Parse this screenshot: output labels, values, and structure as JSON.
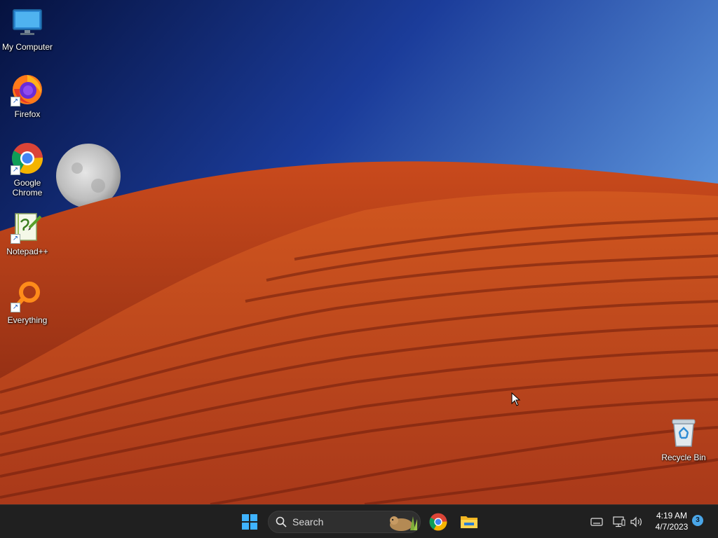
{
  "desktop_icons": [
    {
      "label": "My Computer",
      "icon": "monitor-icon"
    },
    {
      "label": "Firefox",
      "icon": "firefox-icon"
    },
    {
      "label": "Google Chrome",
      "icon": "chrome-icon"
    },
    {
      "label": "Notepad++",
      "icon": "notepadpp-icon"
    },
    {
      "label": "Everything",
      "icon": "everything-search-icon"
    },
    {
      "label": "Recycle Bin",
      "icon": "recycle-bin-icon"
    }
  ],
  "taskbar": {
    "search_label": "Search",
    "pinned": [
      "start-windows-icon",
      "chrome-icon",
      "file-explorer-icon"
    ],
    "tray": [
      "touch-keyboard-icon",
      "network-icon",
      "volume-icon"
    ],
    "time": "4:19 AM",
    "date": "4/7/2023",
    "notification_count": "3"
  },
  "colors": {
    "taskbar": "#202020",
    "sky_top": "#0b1f6b",
    "sky_light": "#5d9de8",
    "dune": "#b8421a"
  }
}
